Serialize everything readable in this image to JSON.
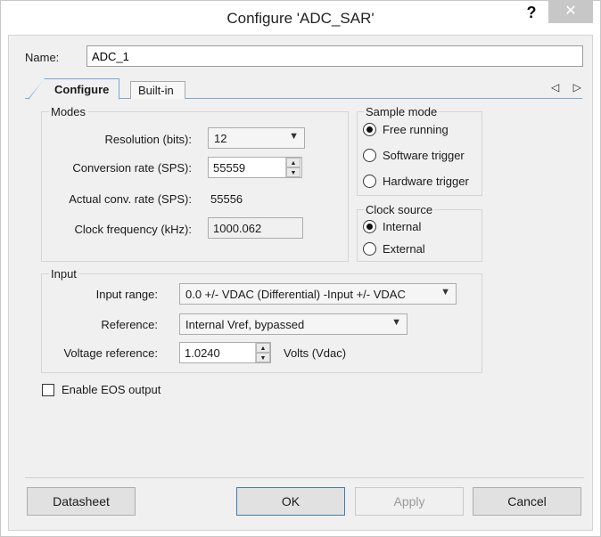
{
  "window": {
    "title": "Configure 'ADC_SAR'",
    "help_glyph": "?",
    "close_glyph": "✕"
  },
  "name": {
    "label": "Name:",
    "value": "ADC_1"
  },
  "tabs": [
    {
      "label": "Configure",
      "active": true
    },
    {
      "label": "Built-in",
      "active": false
    }
  ],
  "tab_nav": "◁ ▷",
  "modes": {
    "legend": "Modes",
    "resolution_label": "Resolution (bits):",
    "resolution_value": "12",
    "conversion_rate_label": "Conversion rate (SPS):",
    "conversion_rate_value": "55559",
    "actual_rate_label": "Actual conv. rate (SPS):",
    "actual_rate_value": "55556",
    "clock_freq_label": "Clock frequency (kHz):",
    "clock_freq_value": "1000.062"
  },
  "sample_mode": {
    "legend": "Sample mode",
    "options": [
      {
        "label": "Free running",
        "checked": true
      },
      {
        "label": "Software trigger",
        "checked": false
      },
      {
        "label": "Hardware trigger",
        "checked": false
      }
    ]
  },
  "clock_source": {
    "legend": "Clock source",
    "options": [
      {
        "label": "Internal",
        "checked": true
      },
      {
        "label": "External",
        "checked": false
      }
    ]
  },
  "input": {
    "legend": "Input",
    "range_label": "Input range:",
    "range_value": "0.0 +/- VDAC (Differential)  -Input +/- VDAC",
    "reference_label": "Reference:",
    "reference_value": "Internal Vref, bypassed",
    "voltage_label": "Voltage reference:",
    "voltage_value": "1.0240",
    "voltage_unit": "Volts (Vdac)"
  },
  "eos": {
    "label": "Enable EOS output",
    "checked": false
  },
  "buttons": {
    "datasheet": "Datasheet",
    "ok": "OK",
    "apply": "Apply",
    "cancel": "Cancel"
  },
  "icons": {
    "dropdown": "▼",
    "spin_up": "▲",
    "spin_down": "▼"
  }
}
